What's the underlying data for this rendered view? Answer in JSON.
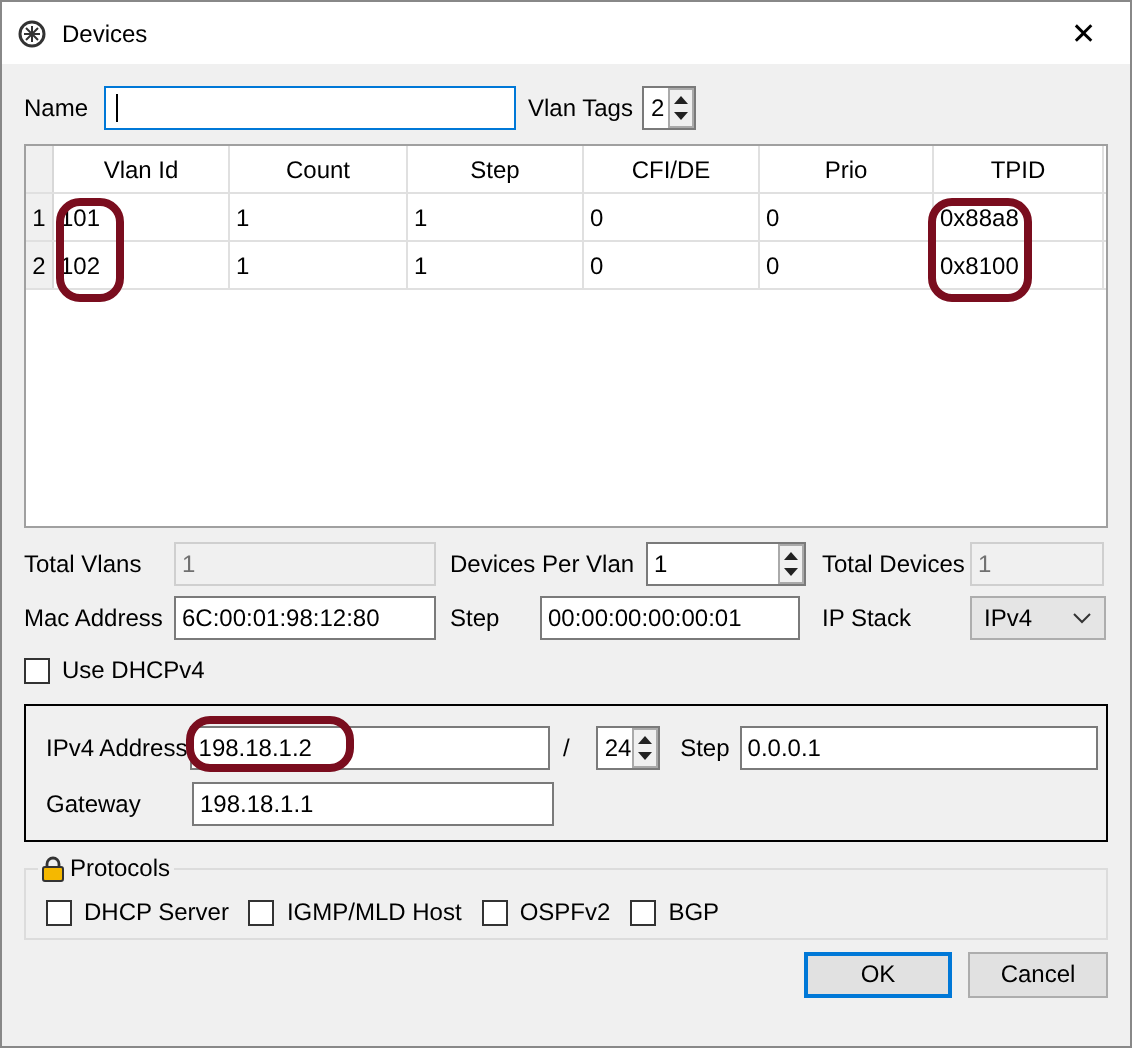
{
  "window": {
    "title": "Devices",
    "close": "✕"
  },
  "name_field": {
    "label": "Name"
  },
  "vlan_tags": {
    "label": "Vlan Tags",
    "value": "2"
  },
  "table": {
    "columns": [
      {
        "label": "Vlan Id",
        "circled": true
      },
      {
        "label": "Count",
        "circled": false
      },
      {
        "label": "Step",
        "circled": false
      },
      {
        "label": "CFI/DE",
        "circled": false
      },
      {
        "label": "Prio",
        "circled": false
      },
      {
        "label": "TPID",
        "circled": true
      }
    ],
    "rows": [
      {
        "number": "1",
        "cells": [
          "101",
          "1",
          "1",
          "0",
          "0",
          "0x88a8"
        ]
      },
      {
        "number": "2",
        "cells": [
          "102",
          "1",
          "1",
          "0",
          "0",
          "0x8100"
        ]
      }
    ]
  },
  "total_vlans": {
    "label": "Total Vlans",
    "value": "1",
    "disabled": true
  },
  "devices_per_vlan": {
    "label": "Devices Per Vlan",
    "value": "1"
  },
  "total_devices": {
    "label": "Total Devices",
    "value": "1",
    "disabled": true
  },
  "mac_address": {
    "label": "Mac Address",
    "value": "6C:00:01:98:12:80"
  },
  "mac_step": {
    "label": "Step",
    "value": "00:00:00:00:00:01"
  },
  "ip_stack": {
    "label": "IP Stack",
    "value": "IPv4"
  },
  "use_dhcp": {
    "label": "Use DHCPv4",
    "checked": false
  },
  "ipv4": {
    "address_label": "IPv4 Address",
    "address": "198.18.1.2",
    "circled": true,
    "slash": "/",
    "prefix": "24",
    "step_label": "Step",
    "step": "0.0.0.1",
    "gateway_label": "Gateway",
    "gateway": "198.18.1.1"
  },
  "protocols": {
    "title": "Protocols",
    "items": [
      {
        "label": "DHCP Server",
        "checked": false
      },
      {
        "label": "IGMP/MLD Host",
        "checked": false
      },
      {
        "label": "OSPFv2",
        "checked": false
      },
      {
        "label": "BGP",
        "checked": false
      }
    ]
  },
  "buttons": [
    {
      "label": "OK",
      "default": true
    },
    {
      "label": "Cancel",
      "default": false
    }
  ]
}
